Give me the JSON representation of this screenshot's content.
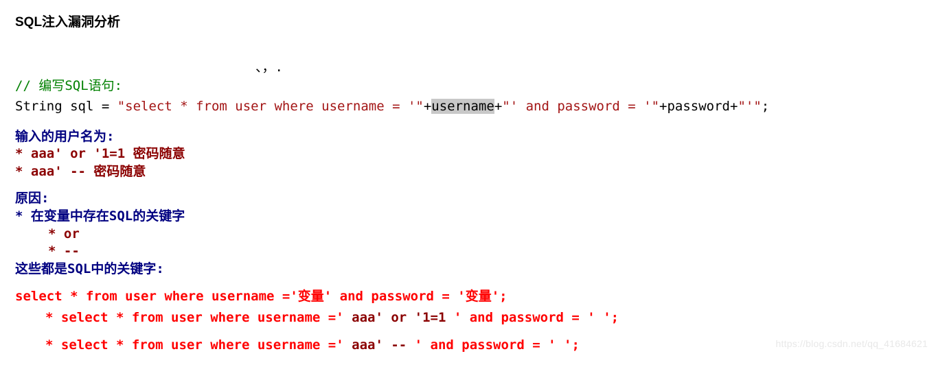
{
  "title": "SQL注入漏洞分析",
  "comma": "、，.",
  "comment": "// 编写SQL语句:",
  "code": {
    "t1": "String sql = ",
    "s1": "\"select * from user where username = '\"",
    "p1": "+",
    "v1": "username",
    "p2": "+",
    "s2": "\"' and password = '\"",
    "p3": "+password+",
    "s3": "\"'\"",
    "end": ";"
  },
  "u_head": "输入的用户名为:",
  "u_l1": "* aaa' or '1=1  密码随意",
  "u_l2": "* aaa' -- 密码随意",
  "cause_head": "原因:",
  "cause_l1": "* 在变量中存在SQL的关键字",
  "cause_l2": "* or",
  "cause_l3": "* --",
  "cause_tail": "这些都是SQL中的关键字:",
  "r1": "select * from user where username ='变量' and password = '变量';",
  "r2a": "* select * from user where username ='",
  "r2b": " aaa' or '1=1 ",
  "r2c": "' and password = '",
  "r2d": "      ",
  "r2e": "';",
  "r3a": "* select * from user where username ='",
  "r3b": " aaa' --     ",
  "r3c": "' and password = '",
  "r3d": "     ",
  "r3e": "';",
  "watermark": "https://blog.csdn.net/qq_41684621"
}
